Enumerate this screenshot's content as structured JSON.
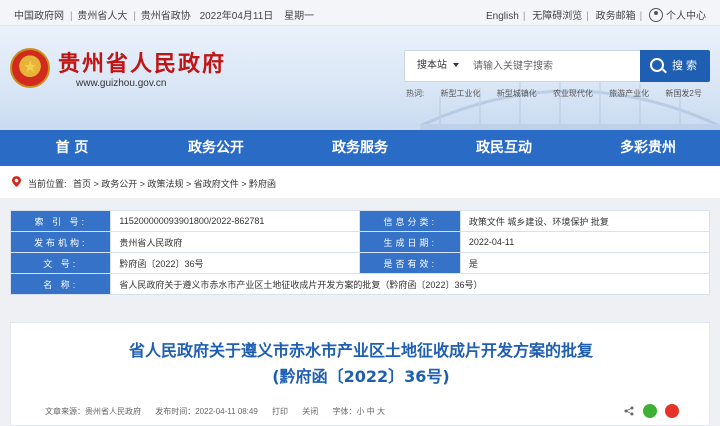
{
  "topbar": {
    "links_left": [
      "中国政府网",
      "贵州省人大",
      "贵州省政协"
    ],
    "date": "2022年04月11日",
    "weekday": "星期一",
    "english": "English",
    "accessibility": "无障碍浏览",
    "gov_mail": "政务邮箱",
    "personal_center": "个人中心"
  },
  "header": {
    "site_title": "贵州省人民政府",
    "site_url": "www.guizhou.gov.cn",
    "search": {
      "scope": "搜本站",
      "placeholder": "请输入关键字搜索",
      "button": "搜 索"
    },
    "hot_label": "热词:",
    "hot_words": [
      "新型工业化",
      "新型城镇化",
      "农业现代化",
      "旅游产业化",
      "新国发2号"
    ]
  },
  "nav": [
    "首 页",
    "政务公开",
    "政务服务",
    "政民互动",
    "多彩贵州"
  ],
  "breadcrumb": {
    "label": "当前位置:",
    "path": "首页 > 政务公开 > 政策法规 > 省政府文件 > 黔府函"
  },
  "info": {
    "index_label": "索 引 号:",
    "index_value": "115200000093901800/2022-862781",
    "category_label": "信息分类:",
    "category_value": "政策文件    城乡建设、环境保护    批复",
    "issuer_label": "发布机构:",
    "issuer_value": "贵州省人民政府",
    "date_label": "生成日期:",
    "date_value": "2022-04-11",
    "docno_label": "文    号:",
    "docno_value": "黔府函〔2022〕36号",
    "valid_label": "是否有效:",
    "valid_value": "是",
    "name_label": "名    称:",
    "name_value": "省人民政府关于遵义市赤水市产业区土地征收成片开发方案的批复（黔府函〔2022〕36号）"
  },
  "article": {
    "title": "省人民政府关于遵义市赤水市产业区土地征收成片开发方案的批复",
    "doc_number": "(黔府函〔2022〕36号)",
    "source": "文章来源：贵州省人民政府",
    "published": "发布时间：2022-04-11 08:49",
    "print": "打印",
    "close": "关闭",
    "font_size": "字体：小 中 大"
  },
  "colors": {
    "primary": "#2a6bc6",
    "title_red": "#c01515",
    "wechat": "#3db035",
    "weibo": "#e6332a"
  }
}
